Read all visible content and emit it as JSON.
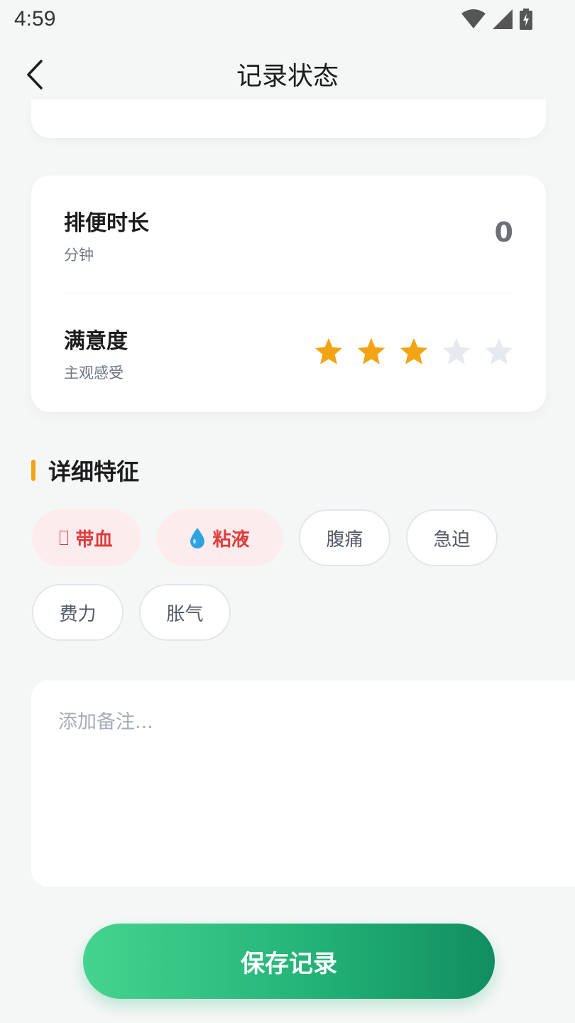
{
  "status_bar": {
    "time": "4:59"
  },
  "nav": {
    "title": "记录状态"
  },
  "duration": {
    "title": "排便时长",
    "unit": "分钟",
    "value": "0"
  },
  "satisfaction": {
    "title": "满意度",
    "subtitle": "主观感受",
    "rating": 3,
    "max": 5
  },
  "details": {
    "title": "详细特征",
    "tags": [
      {
        "label": "带血",
        "icon": "blood-icon",
        "active": true
      },
      {
        "label": "粘液",
        "icon": "water-drop-icon",
        "active": true
      },
      {
        "label": "腹痛",
        "active": false
      },
      {
        "label": "急迫",
        "active": false
      },
      {
        "label": "费力",
        "active": false
      },
      {
        "label": "胀气",
        "active": false
      }
    ]
  },
  "notes": {
    "placeholder": "添加备注..."
  },
  "save_button": {
    "label": "保存记录"
  },
  "colors": {
    "accent": "#23b378",
    "star_on": "#f2a414",
    "star_off": "#e6e9ef",
    "tag_active": "#e13b3b"
  }
}
